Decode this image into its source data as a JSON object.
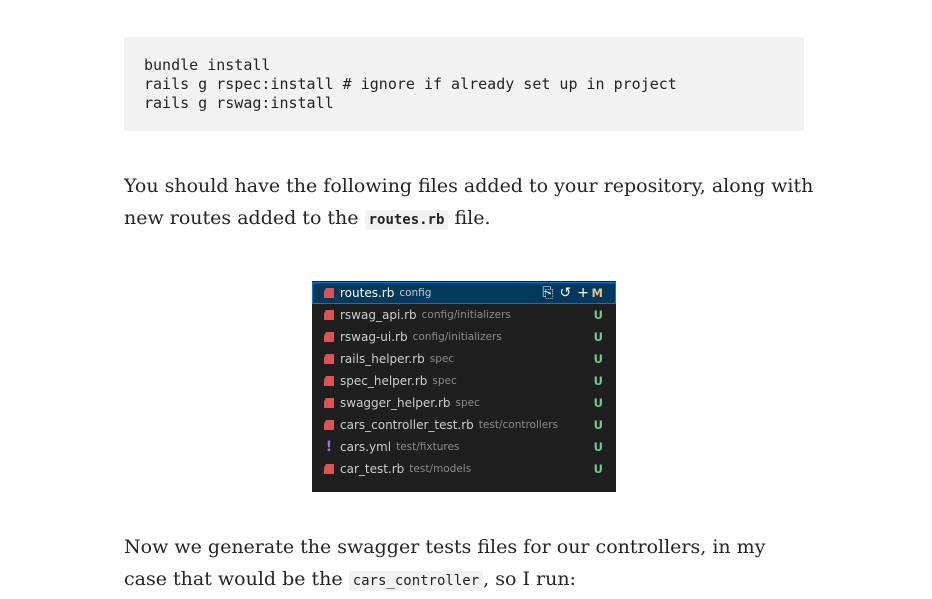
{
  "code_block": {
    "lines": [
      "bundle install",
      "rails g rspec:install # ignore if already set up in project",
      "rails g rswag:install"
    ]
  },
  "paragraph1": {
    "text_before": "You should have the following files added to your repository, along with new routes added to the ",
    "inline_code": "routes.rb",
    "text_after": " file."
  },
  "vscode_panel": {
    "files": [
      {
        "name": "routes.rb",
        "dir": "config",
        "status": "M",
        "icon": "ruby-icon",
        "selected": true
      },
      {
        "name": "rswag_api.rb",
        "dir": "config/initializers",
        "status": "U",
        "icon": "ruby-icon"
      },
      {
        "name": "rswag-ui.rb",
        "dir": "config/initializers",
        "status": "U",
        "icon": "ruby-icon"
      },
      {
        "name": "rails_helper.rb",
        "dir": "spec",
        "status": "U",
        "icon": "ruby-icon"
      },
      {
        "name": "spec_helper.rb",
        "dir": "spec",
        "status": "U",
        "icon": "ruby-icon"
      },
      {
        "name": "swagger_helper.rb",
        "dir": "spec",
        "status": "U",
        "icon": "ruby-icon"
      },
      {
        "name": "cars_controller_test.rb",
        "dir": "test/controllers",
        "status": "U",
        "icon": "ruby-icon"
      },
      {
        "name": "cars.yml",
        "dir": "test/fixtures",
        "status": "U",
        "icon": "yaml-icon",
        "glyph": "!"
      },
      {
        "name": "car_test.rb",
        "dir": "test/models",
        "status": "U",
        "icon": "ruby-icon"
      }
    ],
    "row_actions": [
      "open-file-icon",
      "discard-changes-icon",
      "stage-changes-icon"
    ],
    "colors": {
      "ruby": "#e05252",
      "yaml": "#a074c4",
      "modified": "#e2c08d",
      "untracked": "#73c991",
      "selected_bg": "#04395e"
    }
  },
  "paragraph2": {
    "text_before": "Now we generate the swagger tests files for our controllers, in my case that would be the ",
    "inline_code": "cars_controller",
    "text_after": ", so I run:"
  }
}
